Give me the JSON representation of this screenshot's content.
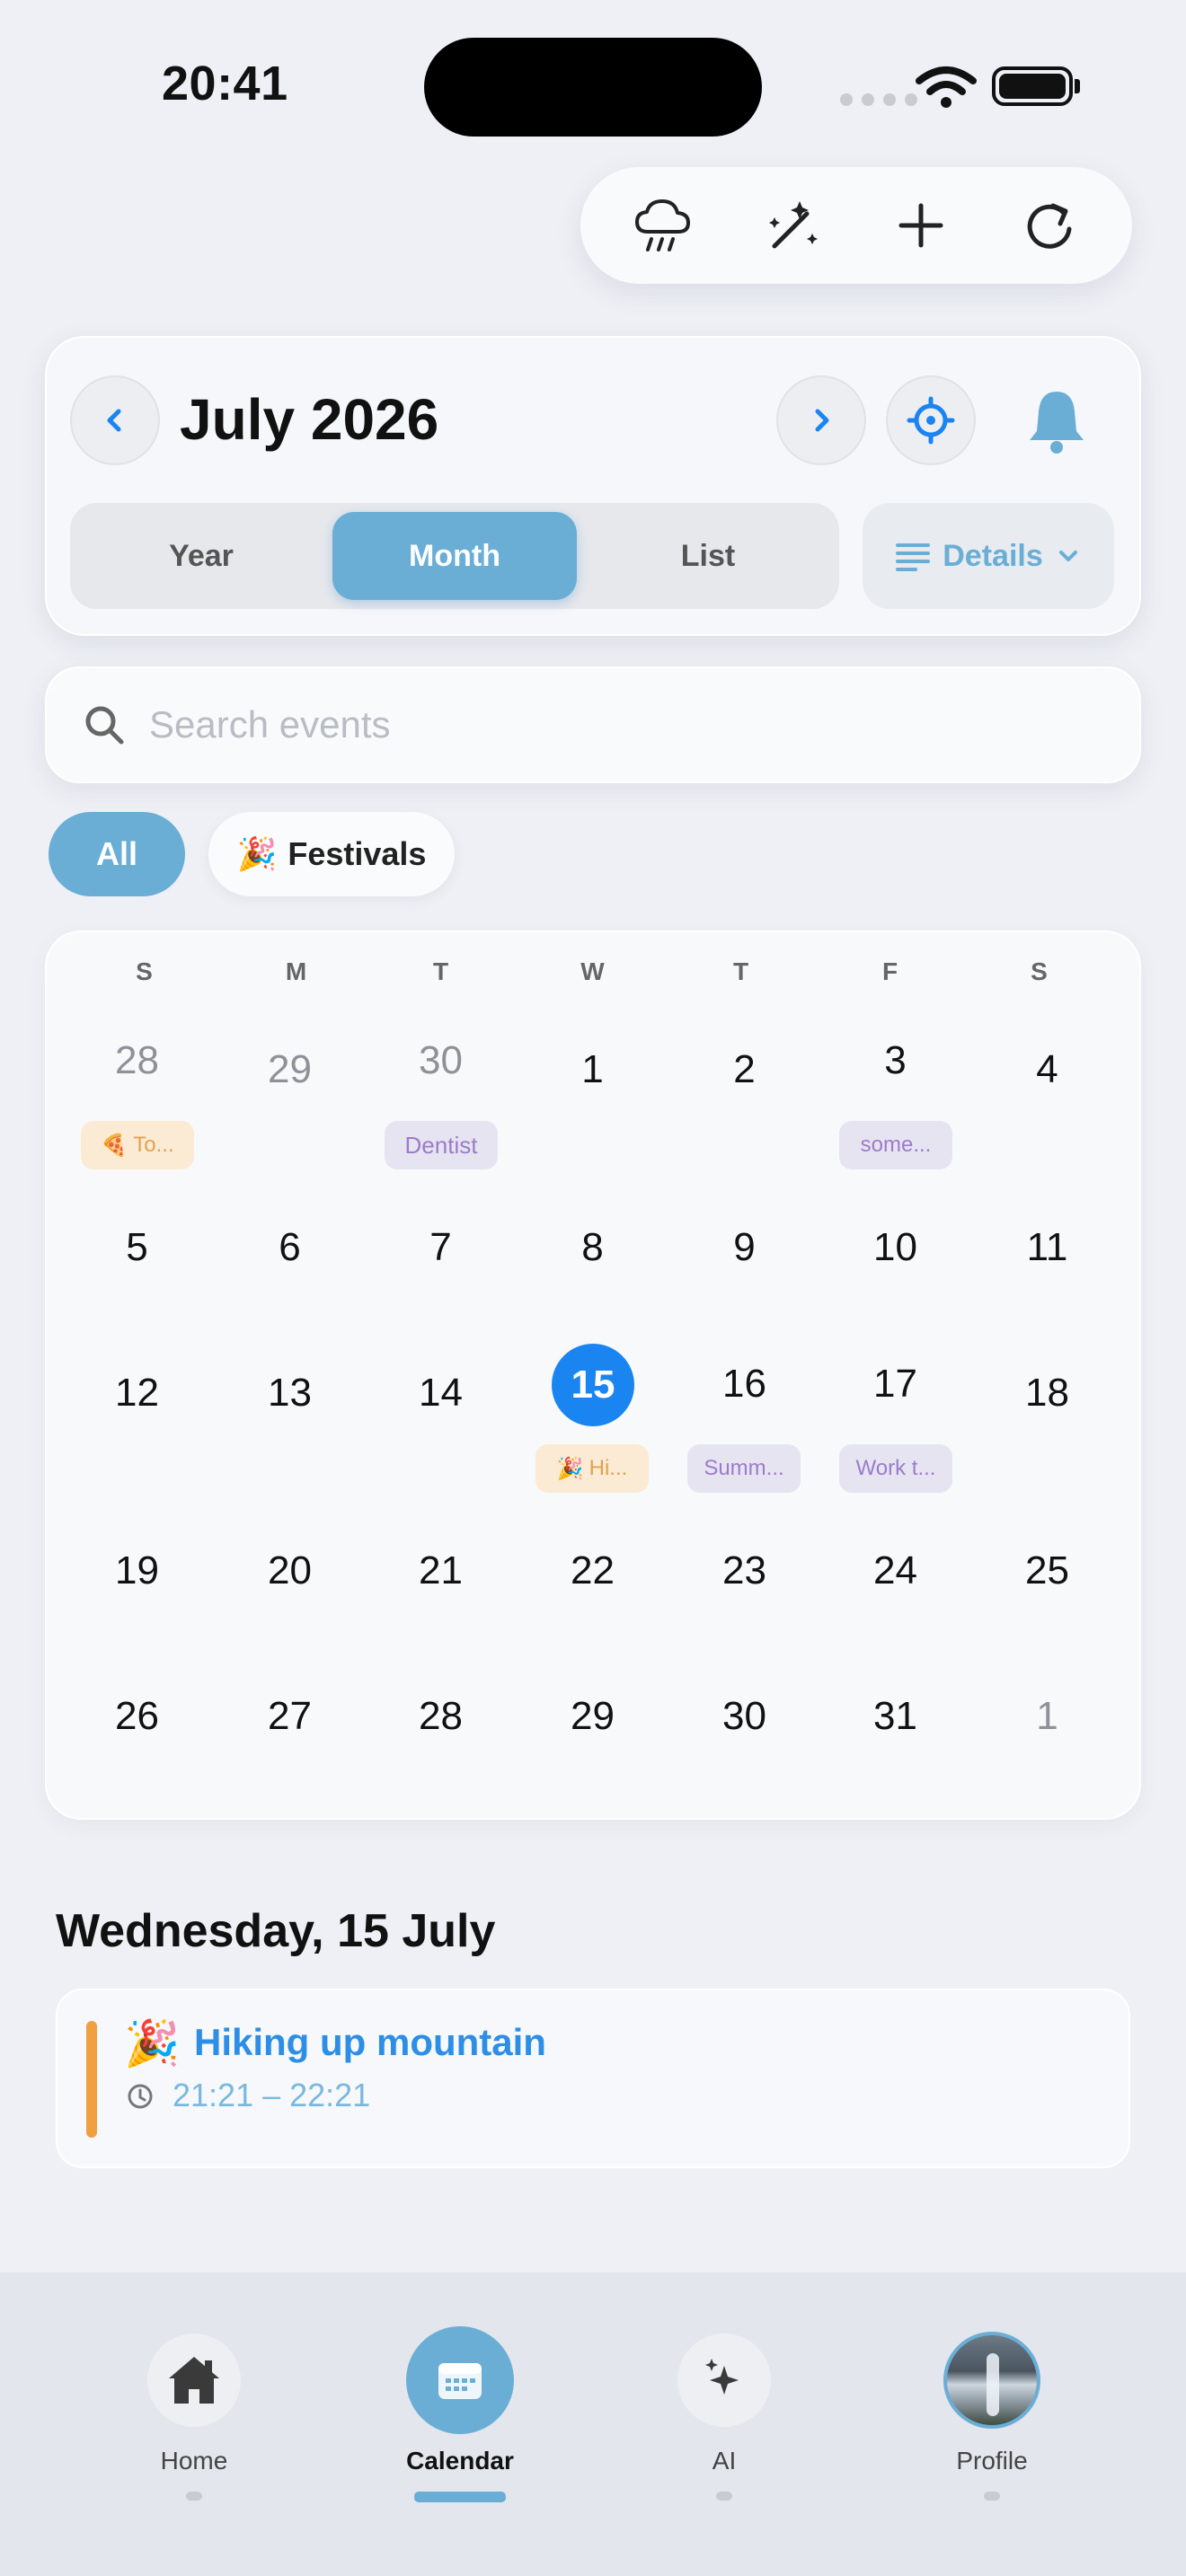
{
  "status_bar": {
    "time": "20:41"
  },
  "toolbar": {
    "icons": [
      "cloud-rain-icon",
      "magic-wand-icon",
      "plus-icon",
      "refresh-icon"
    ]
  },
  "header": {
    "title": "July 2026",
    "view_tabs": [
      "Year",
      "Month",
      "List"
    ],
    "active_tab": "Month",
    "details_label": "Details"
  },
  "search": {
    "placeholder": "Search events"
  },
  "filters": {
    "all": "All",
    "festivals_emoji": "🎉",
    "festivals": "Festivals"
  },
  "calendar": {
    "weekdays": [
      "S",
      "M",
      "T",
      "W",
      "T",
      "F",
      "S"
    ],
    "weeks": [
      [
        "28",
        "29",
        "30",
        "1",
        "2",
        "3",
        "4"
      ],
      [
        "5",
        "6",
        "7",
        "8",
        "9",
        "10",
        "11"
      ],
      [
        "12",
        "13",
        "14",
        "15",
        "16",
        "17",
        "18"
      ],
      [
        "19",
        "20",
        "21",
        "22",
        "23",
        "24",
        "25"
      ],
      [
        "26",
        "27",
        "28",
        "29",
        "30",
        "31",
        "1"
      ]
    ],
    "today": "15",
    "events": {
      "jun28": {
        "emoji": "🍕",
        "label": "To..."
      },
      "jun30": {
        "label": "Dentist"
      },
      "jul3": {
        "label": "some..."
      },
      "jul15": {
        "emoji": "🎉",
        "label": "Hi..."
      },
      "jul16": {
        "label": "Summ..."
      },
      "jul17": {
        "label": "Work t..."
      }
    }
  },
  "selected_day": {
    "title": "Wednesday, 15 July",
    "event": {
      "emoji": "🎉",
      "title": "Hiking up mountain",
      "time": "21:21 – 22:21"
    }
  },
  "tabbar": {
    "home": "Home",
    "calendar": "Calendar",
    "ai": "AI",
    "profile": "Profile"
  },
  "colors": {
    "accent": "#6aaed6",
    "today": "#1a84f0",
    "event_bar": "#f0a040"
  }
}
